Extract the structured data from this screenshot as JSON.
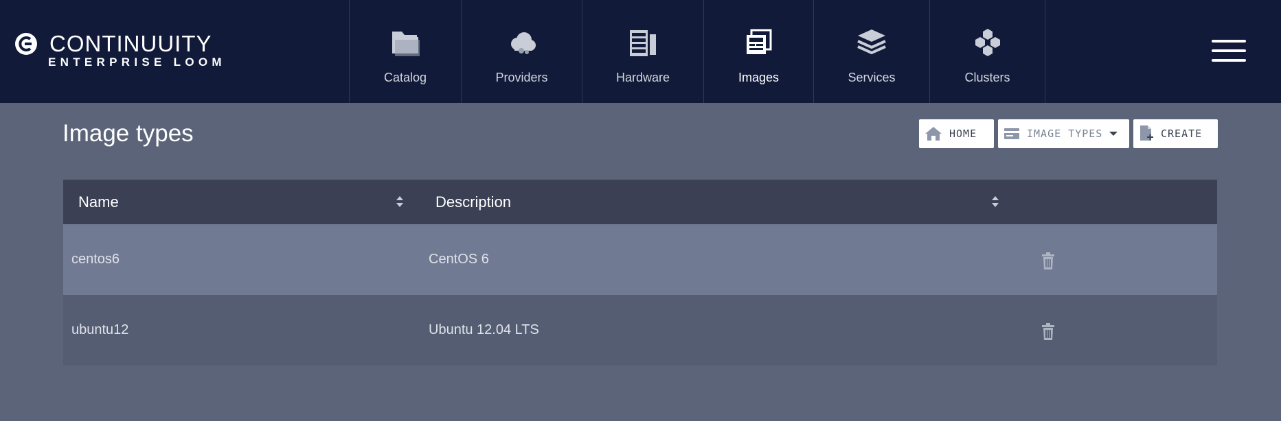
{
  "brand": {
    "title": "CONTINUUITY",
    "subtitle": "ENTERPRISE LOOM"
  },
  "nav": {
    "active": "Images",
    "tabs": [
      {
        "label": "Catalog",
        "icon": "folder-icon"
      },
      {
        "label": "Providers",
        "icon": "cloud-icon"
      },
      {
        "label": "Hardware",
        "icon": "server-rack-icon"
      },
      {
        "label": "Images",
        "icon": "image-stack-icon"
      },
      {
        "label": "Services",
        "icon": "layers-icon"
      },
      {
        "label": "Clusters",
        "icon": "cubes-icon"
      }
    ],
    "menu_icon": "hamburger-menu-icon"
  },
  "page": {
    "title": "Image types"
  },
  "toolbar": {
    "home_label": "HOME",
    "types_label": "IMAGE TYPES",
    "create_label": "CREATE"
  },
  "table": {
    "columns": [
      "Name",
      "Description"
    ],
    "rows": [
      {
        "name": "centos6",
        "description": "CentOS 6"
      },
      {
        "name": "ubuntu12",
        "description": "Ubuntu 12.04 LTS"
      }
    ]
  },
  "colors": {
    "topbar": "#111a38",
    "page_background": "#5c6479",
    "table_header": "#3b4054",
    "row_highlight": "#717a93",
    "row_normal": "#555d72"
  }
}
